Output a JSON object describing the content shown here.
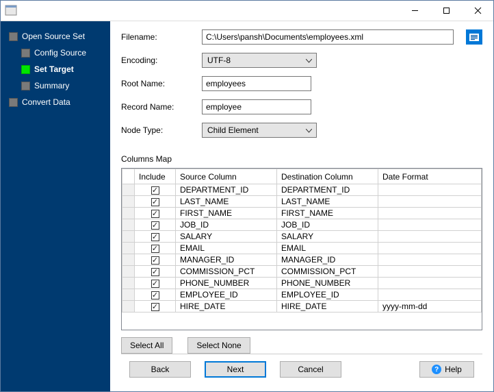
{
  "sidebar": {
    "items": [
      {
        "label": "Open Source Set",
        "level": 0
      },
      {
        "label": "Config Source",
        "level": 1
      },
      {
        "label": "Set Target",
        "level": 1,
        "current": true
      },
      {
        "label": "Summary",
        "level": 1
      },
      {
        "label": "Convert Data",
        "level": 0
      }
    ]
  },
  "form": {
    "filename_label": "Filename:",
    "filename": "C:\\Users\\pansh\\Documents\\employees.xml",
    "encoding_label": "Encoding:",
    "encoding": "UTF-8",
    "root_label": "Root Name:",
    "root": "employees",
    "record_label": "Record Name:",
    "record": "employee",
    "nodetype_label": "Node Type:",
    "nodetype": "Child Element"
  },
  "columns_map": {
    "title": "Columns Map",
    "headers": {
      "include": "Include",
      "source": "Source Column",
      "destination": "Destination Column",
      "date_format": "Date Format"
    },
    "rows": [
      {
        "include": true,
        "source": "DEPARTMENT_ID",
        "dest": "DEPARTMENT_ID",
        "date": ""
      },
      {
        "include": true,
        "source": "LAST_NAME",
        "dest": "LAST_NAME",
        "date": ""
      },
      {
        "include": true,
        "source": "FIRST_NAME",
        "dest": "FIRST_NAME",
        "date": ""
      },
      {
        "include": true,
        "source": "JOB_ID",
        "dest": "JOB_ID",
        "date": ""
      },
      {
        "include": true,
        "source": "SALARY",
        "dest": "SALARY",
        "date": ""
      },
      {
        "include": true,
        "source": "EMAIL",
        "dest": "EMAIL",
        "date": ""
      },
      {
        "include": true,
        "source": "MANAGER_ID",
        "dest": "MANAGER_ID",
        "date": ""
      },
      {
        "include": true,
        "source": "COMMISSION_PCT",
        "dest": "COMMISSION_PCT",
        "date": ""
      },
      {
        "include": true,
        "source": "PHONE_NUMBER",
        "dest": "PHONE_NUMBER",
        "date": ""
      },
      {
        "include": true,
        "source": "EMPLOYEE_ID",
        "dest": "EMPLOYEE_ID",
        "date": ""
      },
      {
        "include": true,
        "source": "HIRE_DATE",
        "dest": "HIRE_DATE",
        "date": "yyyy-mm-dd"
      }
    ]
  },
  "buttons": {
    "select_all": "Select All",
    "select_none": "Select None",
    "back": "Back",
    "next": "Next",
    "cancel": "Cancel",
    "help": "Help"
  }
}
